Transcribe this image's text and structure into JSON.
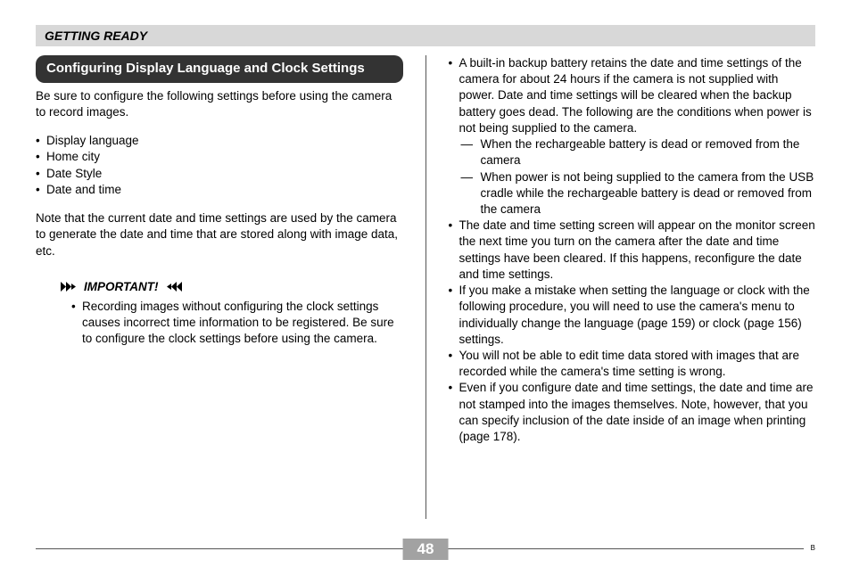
{
  "header": "GETTING READY",
  "section_title": "Configuring Display Language and Clock Settings",
  "intro": "Be sure to configure the following settings before using the camera to record images.",
  "settings": [
    "Display language",
    "Home city",
    "Date Style",
    "Date and time"
  ],
  "note": "Note that the current date and time settings are used by the camera to generate the date and time that are stored along with image data, etc.",
  "important_label": "IMPORTANT!",
  "important_items": [
    "Recording images without configuring the clock settings causes incorrect time information to be registered. Be sure to configure the clock settings before using the camera."
  ],
  "right_items": [
    {
      "text": "A built-in backup battery retains the date and time settings of the camera for about 24 hours if the camera is not supplied with power. Date and time settings will be cleared when the backup battery goes dead. The following are the conditions when power is not being supplied to the camera.",
      "sub": [
        "When the rechargeable battery is dead or removed from the camera",
        "When power is not being supplied to the camera from the USB cradle while the rechargeable battery is dead or removed from the camera"
      ]
    },
    {
      "text": "The date and time setting screen will appear on the monitor screen the next time you turn on the camera after the date and time settings have been cleared. If this happens, reconfigure the date and time settings."
    },
    {
      "text": "If you make a mistake when setting the language or clock with the following procedure, you will need to use the camera's menu to individually change the language (page 159) or clock (page 156) settings."
    },
    {
      "text": "You will not be able to edit time data stored with images that are recorded while the camera's time setting is wrong."
    },
    {
      "text": "Even if you configure date and time settings, the date and time are not stamped into the images themselves. Note, however, that you can specify inclusion of the date inside of an image when printing (page 178)."
    }
  ],
  "page_number": "48",
  "footer_mark": "B"
}
